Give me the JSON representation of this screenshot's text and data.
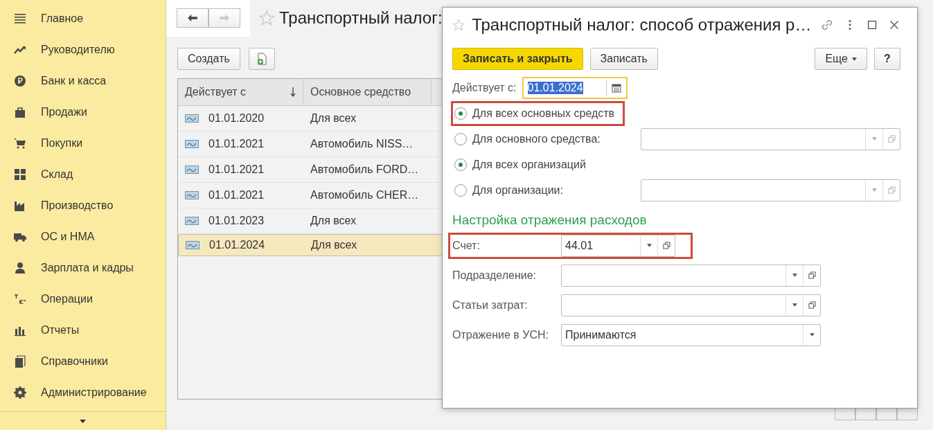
{
  "sidebar": {
    "items": [
      {
        "label": "Главное",
        "selected": false
      },
      {
        "label": "Руководителю",
        "selected": false
      },
      {
        "label": "Банк и касса",
        "selected": false
      },
      {
        "label": "Продажи",
        "selected": false
      },
      {
        "label": "Покупки",
        "selected": false
      },
      {
        "label": "Склад",
        "selected": false
      },
      {
        "label": "Производство",
        "selected": false
      },
      {
        "label": "ОС и НМА",
        "selected": false
      },
      {
        "label": "Зарплата и кадры",
        "selected": false
      },
      {
        "label": "Операции",
        "selected": false
      },
      {
        "label": "Отчеты",
        "selected": false
      },
      {
        "label": "Справочники",
        "selected": false
      },
      {
        "label": "Администрирование",
        "selected": false
      }
    ]
  },
  "list_form": {
    "title": "Транспортный налог:",
    "create_button": "Создать",
    "table": {
      "columns": [
        {
          "label": "Действует с",
          "sorted": true
        },
        {
          "label": "Основное средство",
          "sorted": false
        }
      ],
      "rows": [
        {
          "date": "01.01.2020",
          "asset": "Для всех",
          "selected": false
        },
        {
          "date": "01.01.2021",
          "asset": "Автомобиль NISS…",
          "selected": false
        },
        {
          "date": "01.01.2021",
          "asset": "Автомобиль FORD…",
          "selected": false
        },
        {
          "date": "01.01.2021",
          "asset": "Автомобиль CHER…",
          "selected": false
        },
        {
          "date": "01.01.2023",
          "asset": "Для всех",
          "selected": false
        },
        {
          "date": "01.01.2024",
          "asset": "Для всех",
          "selected": true
        }
      ]
    }
  },
  "dialog": {
    "title": "Транспортный налог: способ отражения р…",
    "buttons": [
      {
        "label": "Записать и закрыть",
        "kind": "primary"
      },
      {
        "label": "Записать",
        "kind": "normal"
      }
    ],
    "more_button": "Еще",
    "help_button": "?",
    "valid_from": {
      "label": "Действует с:",
      "value": "01.01.2024"
    },
    "radios": [
      {
        "label": "Для всех основных средств",
        "selected": true,
        "highlighted": true,
        "kind": "plain"
      },
      {
        "label": "Для основного средства:",
        "selected": false,
        "highlighted": false,
        "kind": "field"
      },
      {
        "label": "Для всех организаций",
        "selected": true,
        "highlighted": false,
        "kind": "plain"
      },
      {
        "label": "Для организации:",
        "selected": false,
        "highlighted": false,
        "kind": "field"
      }
    ],
    "section_title": "Настройка отражения расходов",
    "fields": [
      {
        "label": "Счет:",
        "value": "44.01",
        "kind": "short",
        "highlighted": true
      },
      {
        "label": "Подразделение:",
        "kind": "select_open",
        "highlighted": false
      },
      {
        "label": "Статьи затрат:",
        "kind": "select_open",
        "highlighted": false
      },
      {
        "label": "Отражение в УСН:",
        "value": "Принимаются",
        "kind": "select",
        "highlighted": false
      }
    ]
  }
}
